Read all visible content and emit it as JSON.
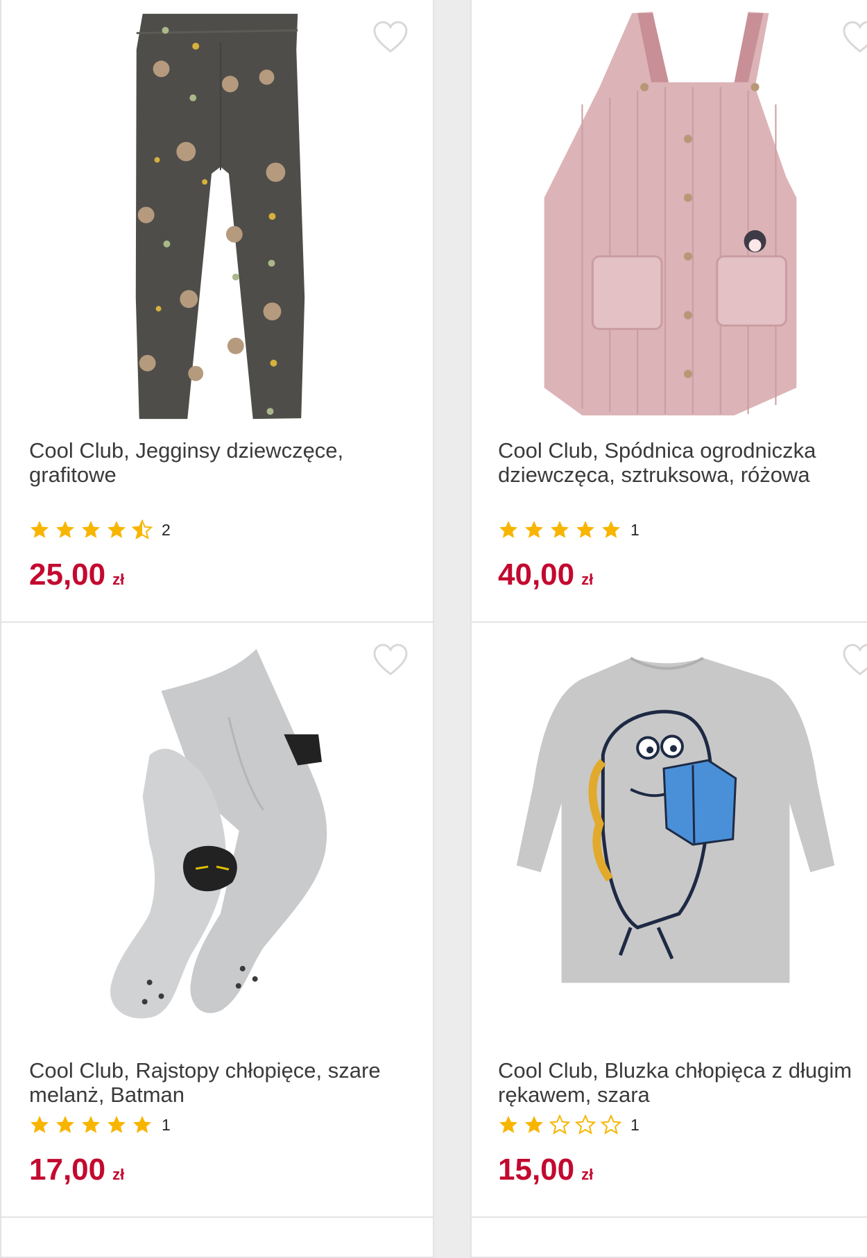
{
  "products": [
    {
      "title": "Cool Club, Jegginsy dziewczęce, grafitowe",
      "rating": 4.5,
      "rating_count": "2",
      "price": "25,00",
      "currency": "zł",
      "image": "leggings-image"
    },
    {
      "title": "Cool Club, Spódnica ogrodniczka dziewczęca, sztruksowa, różowa",
      "rating": 5,
      "rating_count": "1",
      "price": "40,00",
      "currency": "zł",
      "image": "pinafore-dress-image"
    },
    {
      "title": "Cool Club, Rajstopy chłopięce, szare melanż, Batman",
      "rating": 5,
      "rating_count": "1",
      "price": "17,00",
      "currency": "zł",
      "image": "tights-image"
    },
    {
      "title": "Cool Club, Bluzka chłopięca z długim rękawem, szara",
      "rating": 2,
      "rating_count": "1",
      "price": "15,00",
      "currency": "zł",
      "image": "longsleeve-shirt-image"
    }
  ],
  "colors": {
    "price": "#c3092f",
    "star": "#f7b500",
    "text": "#3a3a3a"
  },
  "icons": {
    "favorite": "heart-outline-icon",
    "star_full": "star-icon",
    "star_half": "star-half-icon",
    "star_empty": "star-outline-icon"
  }
}
